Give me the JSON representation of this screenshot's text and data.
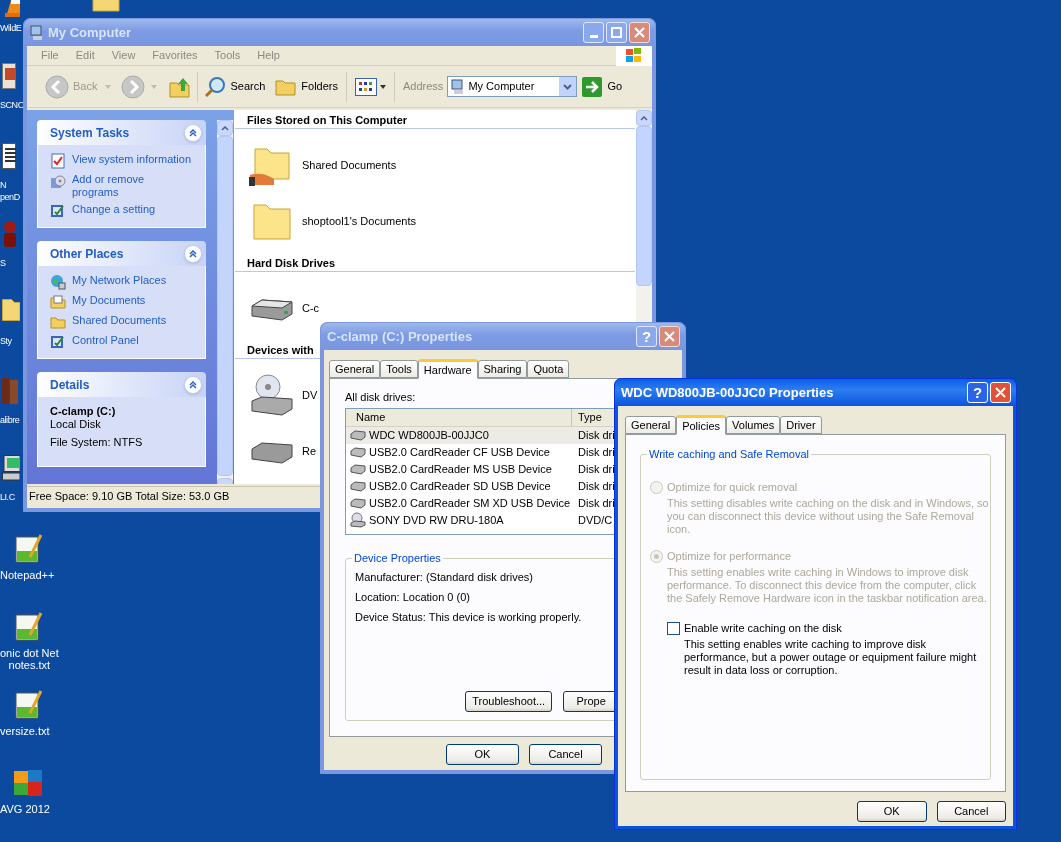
{
  "desktop": {
    "icons": [
      {
        "kind": "cone",
        "lines": [
          "WildE"
        ]
      },
      {
        "kind": "app",
        "lines": [
          "SCNC"
        ]
      },
      {
        "kind": "document",
        "lines": [
          "N",
          "penD"
        ]
      },
      {
        "kind": "red",
        "lines": [
          "S"
        ]
      },
      {
        "kind": "folder",
        "lines": [
          "Sty"
        ]
      },
      {
        "kind": "books",
        "lines": [
          "alibre"
        ]
      },
      {
        "kind": "computer",
        "lines": [
          "LI.C"
        ]
      },
      {
        "kind": "notepad",
        "lines": [
          "Notepad++"
        ]
      },
      {
        "kind": "notepad",
        "lines": [
          "onic dot Net",
          "notes.txt"
        ]
      },
      {
        "kind": "notepad",
        "lines": [
          "versize.txt"
        ]
      },
      {
        "kind": "avg",
        "lines": [
          "AVG 2012"
        ]
      },
      {
        "kind": "folder"
      }
    ]
  },
  "explorer": {
    "title": "My Computer",
    "active": false,
    "menu": [
      "File",
      "Edit",
      "View",
      "Favorites",
      "Tools",
      "Help"
    ],
    "toolbar": {
      "back": "Back",
      "search": "Search",
      "folders": "Folders",
      "address_label": "Address",
      "address": "My Computer",
      "go": "Go"
    },
    "task_panels": [
      {
        "title": "System Tasks",
        "items": [
          {
            "kind": "info",
            "label": "View system information"
          },
          {
            "kind": "programs",
            "label": "Add or remove programs"
          },
          {
            "kind": "setting",
            "label": "Change a setting"
          }
        ]
      },
      {
        "title": "Other Places",
        "items": [
          {
            "kind": "network",
            "label": "My Network Places"
          },
          {
            "kind": "documents",
            "label": "My Documents"
          },
          {
            "kind": "folder",
            "label": "Shared Documents"
          },
          {
            "kind": "setting",
            "label": "Control Panel"
          }
        ]
      }
    ],
    "details": {
      "title": "Details",
      "name": "C-clamp (C:)",
      "type": "Local Disk",
      "file_system": "File System: NTFS"
    },
    "sections": [
      {
        "heading": "Files Stored on This Computer",
        "items": [
          {
            "kind": "shared-folder",
            "label": "Shared Documents"
          },
          {
            "kind": "folder",
            "label": "shoptool1's Documents"
          }
        ]
      },
      {
        "heading": "Hard Disk Drives",
        "items": [
          {
            "kind": "drive",
            "label": "C-c"
          }
        ]
      },
      {
        "heading": "Devices with",
        "items": [
          {
            "kind": "dvd",
            "label": "DV"
          },
          {
            "kind": "removable",
            "label": "Re"
          }
        ]
      }
    ],
    "status_bar": "Free Space: 9.10 GB Total Size: 53.0 GB"
  },
  "hardware_dialog": {
    "title": "C-clamp (C:) Properties",
    "active": false,
    "help": "?",
    "tabs": [
      {
        "label": "General",
        "selected": false
      },
      {
        "label": "Tools",
        "selected": false
      },
      {
        "label": "Hardware",
        "selected": true
      },
      {
        "label": "Sharing",
        "selected": false
      },
      {
        "label": "Quota",
        "selected": false
      }
    ],
    "list_label": "All disk drives:",
    "columns": [
      "Name",
      "Type"
    ],
    "rows": [
      {
        "kind": "disk",
        "name": "WDC WD800JB-00JJC0",
        "type": "Disk dri",
        "selected": true
      },
      {
        "kind": "disk",
        "name": "USB2.0 CardReader CF USB Device",
        "type": "Disk dri",
        "selected": false
      },
      {
        "kind": "disk",
        "name": "USB2.0 CardReader MS USB Device",
        "type": "Disk dri",
        "selected": false
      },
      {
        "kind": "disk",
        "name": "USB2.0 CardReader SD USB Device",
        "type": "Disk dri",
        "selected": false
      },
      {
        "kind": "disk",
        "name": "USB2.0 CardReader SM XD USB Device",
        "type": "Disk dri",
        "selected": false
      },
      {
        "kind": "dvd",
        "name": "SONY DVD RW DRU-180A",
        "type": "DVD/C",
        "selected": false
      }
    ],
    "group_title": "Device Properties",
    "properties": [
      "Manufacturer: (Standard disk drives)",
      "Location: Location 0 (0)",
      "Device Status: This device is working properly."
    ],
    "group_buttons": [
      "Troubleshoot...",
      "Prope"
    ],
    "buttons": [
      "OK",
      "Cancel"
    ]
  },
  "policies_dialog": {
    "title": "WDC WD800JB-00JJC0 Properties",
    "active": true,
    "help": "?",
    "tabs": [
      {
        "label": "General",
        "selected": false
      },
      {
        "label": "Policies",
        "selected": true
      },
      {
        "label": "Volumes",
        "selected": false
      },
      {
        "label": "Driver",
        "selected": false
      }
    ],
    "group_title": "Write caching and Safe Removal",
    "options": [
      {
        "label": "Optimize for quick removal",
        "description": "This setting disables write caching on the disk and in Windows, so you can disconnect this device without using the Safe Removal icon.",
        "selected": false,
        "disabled": true
      },
      {
        "label": "Optimize for performance",
        "description": "This setting enables write caching in Windows to improve disk performance. To disconnect this device from the computer, click the Safely Remove Hardware icon in the taskbar notification area.",
        "selected": true,
        "disabled": true
      }
    ],
    "checkbox": {
      "label": "Enable write caching on the disk",
      "description": "This setting enables write caching to improve disk performance, but a power outage or equipment failure might result in data loss or corruption.",
      "checked": false,
      "disabled": false
    },
    "buttons": [
      "OK",
      "Cancel"
    ]
  }
}
